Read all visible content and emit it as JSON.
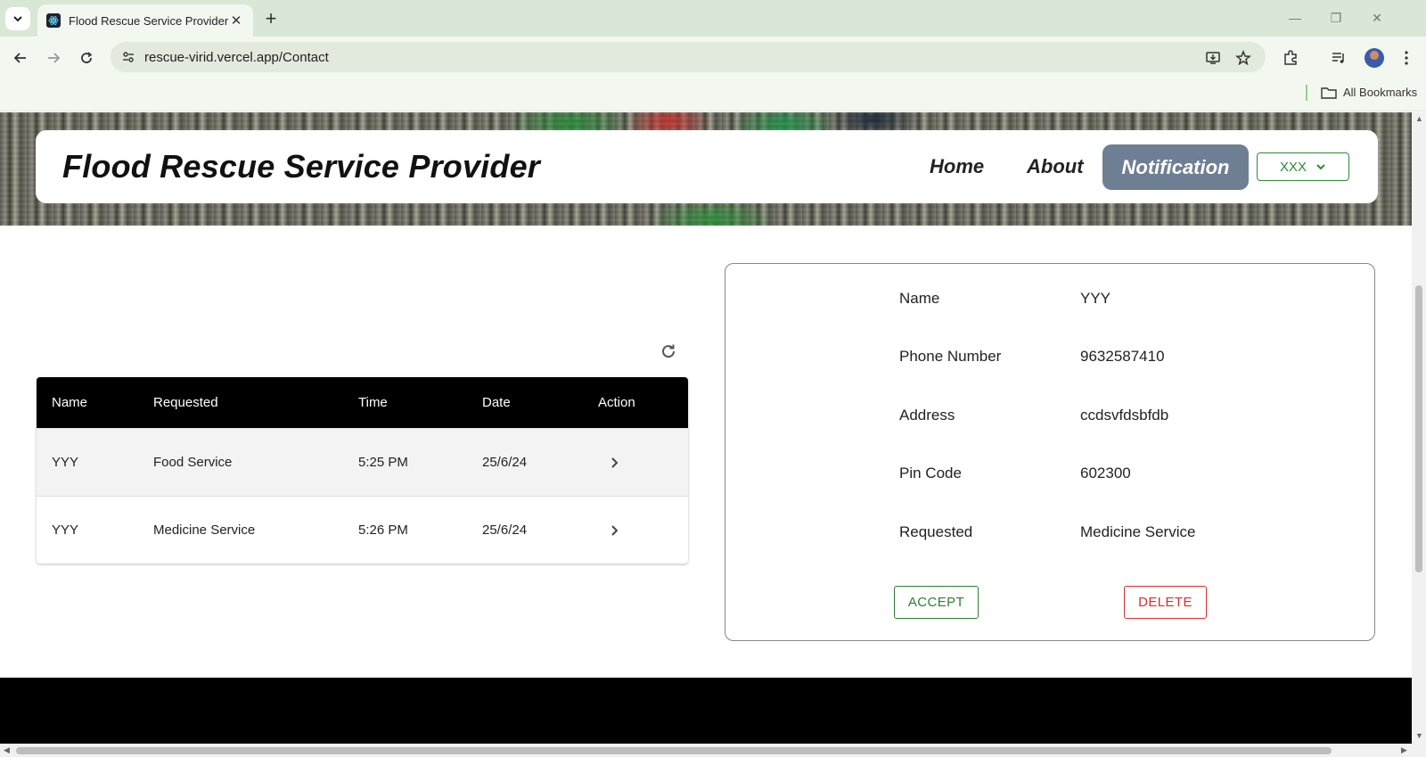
{
  "browser": {
    "tab_title": "Flood Rescue Service Provider",
    "url": "rescue-virid.vercel.app/Contact",
    "bookmarks_label": "All Bookmarks"
  },
  "nav": {
    "brand": "Flood Rescue Service Provider",
    "links": [
      "Home",
      "About",
      "Notification"
    ],
    "user_label": "XXX"
  },
  "table": {
    "columns": [
      "Name",
      "Requested",
      "Time",
      "Date",
      "Action"
    ],
    "rows": [
      {
        "name": "YYY",
        "requested": "Food Service",
        "time": "5:25 PM",
        "date": "25/6/24"
      },
      {
        "name": "YYY",
        "requested": "Medicine Service",
        "time": "5:26 PM",
        "date": "25/6/24"
      }
    ]
  },
  "detail": {
    "fields": [
      {
        "label": "Name",
        "value": "YYY"
      },
      {
        "label": "Phone Number",
        "value": "9632587410"
      },
      {
        "label": "Address",
        "value": "ccdsvfdsbfdb"
      },
      {
        "label": "Pin Code",
        "value": "602300"
      },
      {
        "label": "Requested",
        "value": "Medicine Service"
      }
    ],
    "accept_label": "ACCEPT",
    "delete_label": "DELETE"
  },
  "colors": {
    "notification_bg": "#6e7f93",
    "accept": "#2e7d32",
    "delete": "#d32f2f",
    "header_bg": "#000000"
  }
}
